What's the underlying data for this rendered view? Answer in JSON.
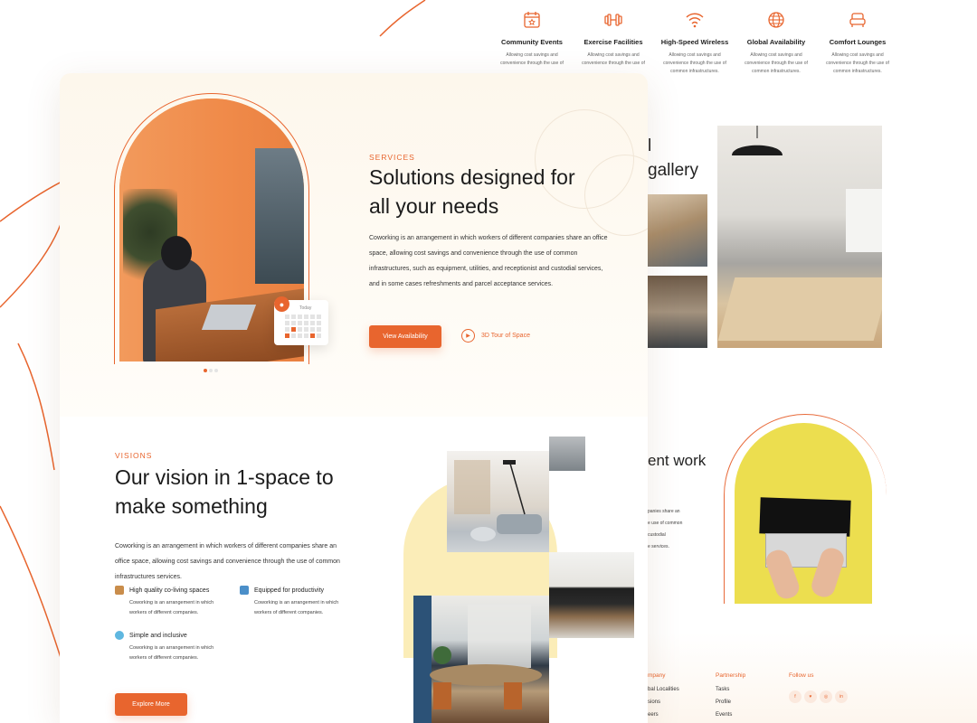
{
  "features": [
    {
      "title": "Community Events",
      "desc": "Allowing cost savings and convenience through the use of",
      "icon": "calendar-star-icon"
    },
    {
      "title": "Exercise Facilities",
      "desc": "Allowing cost savings and convenience through the use of",
      "icon": "dumbbell-icon"
    },
    {
      "title": "High-Speed Wireless",
      "desc": "Allowing cost savings and convenience through the use of common infrastructures.",
      "icon": "wifi-icon"
    },
    {
      "title": "Global Availability",
      "desc": "Allowing cost savings and convenience through the use of common infrastructures.",
      "icon": "globe-icon"
    },
    {
      "title": "Comfort Lounges",
      "desc": "Allowing cost savings and convenience through the use of common infrastructures.",
      "icon": "armchair-icon"
    }
  ],
  "gallery": {
    "title_line1": "l",
    "title_line2": "gallery"
  },
  "generation": {
    "title": "ent work",
    "text_lines": [
      "panies share an",
      "e use of common",
      "custodial",
      "e services."
    ]
  },
  "footer": {
    "company": {
      "heading": "mpany",
      "links": [
        "bal Localities",
        "sions",
        "eers"
      ]
    },
    "partnership": {
      "heading": "Partnership",
      "links": [
        "Tasks",
        "Profile",
        "Events"
      ]
    },
    "follow": {
      "heading": "Follow us",
      "icons": [
        "f",
        "♥",
        "◎",
        "in"
      ]
    }
  },
  "hero": {
    "eyebrow": "SERVICES",
    "title_line1": "Solutions designed for",
    "title_line2": "all your needs",
    "paragraph": "Coworking is an arrangement in which workers of different companies share an office space, allowing cost savings and convenience through the use of common infrastructures, such as equipment, utilities, and receptionist and custodial services, and in some cases refreshments and parcel acceptance services.",
    "primary_button": "View Availability",
    "tour_button": "3D Tour of Space",
    "calendar_label": "Today",
    "slide_count": 3,
    "active_slide": 1
  },
  "visions": {
    "eyebrow": "VISIONS",
    "title_line1": "Our vision in 1-space to",
    "title_line2": "make something",
    "paragraph": "Coworking is an arrangement in which workers of different companies share an office space, allowing cost savings and convenience through the use of common infrastructures services.",
    "items": [
      {
        "title": "High quality co-living spaces",
        "desc": "Coworking is an arrangement in which workers of different companies.",
        "icon": "hotel-icon"
      },
      {
        "title": "Equipped for productivity",
        "desc": "Coworking is an arrangement in which workers of different companies.",
        "icon": "toolbox-icon"
      },
      {
        "title": "Simple and inclusive",
        "desc": "Coworking is an arrangement in which workers of different companies.",
        "icon": "droplet-icon"
      }
    ],
    "button": "Explore More"
  },
  "colors": {
    "accent": "#e8652e",
    "yellow": "#ecde4f",
    "cream": "#fdf7ec"
  }
}
